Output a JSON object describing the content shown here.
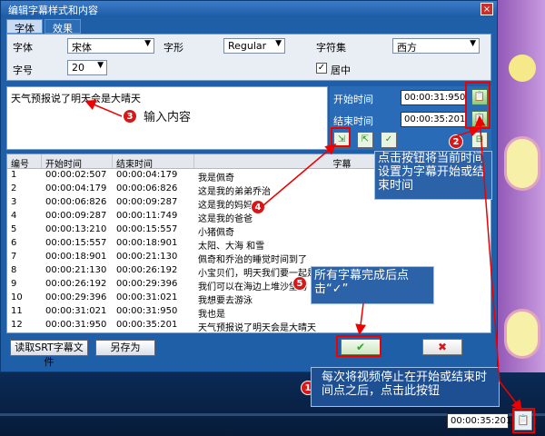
{
  "window": {
    "title": "编辑字幕样式和内容",
    "close": "×"
  },
  "tabs": [
    {
      "label": "字体"
    },
    {
      "label": "效果"
    }
  ],
  "props": {
    "font_label": "字体",
    "font_value": "宋体",
    "style_label": "字形",
    "style_value": "Regular",
    "charset_label": "字符集",
    "charset_value": "西方",
    "size_label": "字号",
    "size_value": "20",
    "center_label": "居中",
    "center_checked": "✓"
  },
  "editor": {
    "text": "天气预报说了明天会是大晴天"
  },
  "time": {
    "start_label": "开始时间",
    "start_value": "00:00:31:950",
    "end_label": "结束时间",
    "end_value": "00:00:35:201"
  },
  "table": {
    "headers": [
      "编号",
      "开始时间",
      "结束时间",
      "字幕"
    ],
    "rows": [
      [
        "1",
        "00:00:02:507",
        "00:00:04:179",
        "我是佩奇"
      ],
      [
        "2",
        "00:00:04:179",
        "00:00:06:826",
        "这是我的弟弟乔治"
      ],
      [
        "3",
        "00:00:06:826",
        "00:00:09:287",
        "这是我的妈妈"
      ],
      [
        "4",
        "00:00:09:287",
        "00:00:11:749",
        "这是我的爸爸"
      ],
      [
        "5",
        "00:00:13:210",
        "00:00:15:557",
        "小猪佩奇"
      ],
      [
        "6",
        "00:00:15:557",
        "00:00:18:901",
        "太阳、大海 和雪"
      ],
      [
        "7",
        "00:00:18:901",
        "00:00:21:130",
        "佩奇和乔治的睡觉时间到了"
      ],
      [
        "8",
        "00:00:21:130",
        "00:00:26:192",
        "小宝贝们，明天我们要一起是"
      ],
      [
        "9",
        "00:00:26:192",
        "00:00:29:396",
        "我们可以在海边上堆沙堡吗"
      ],
      [
        "10",
        "00:00:29:396",
        "00:00:31:021",
        "我想要去游泳"
      ],
      [
        "11",
        "00:00:31:021",
        "00:00:31:950",
        "我也是"
      ],
      [
        "12",
        "00:00:31:950",
        "00:00:35:201",
        "天气预报说了明天会是大晴天"
      ]
    ]
  },
  "buttons": {
    "read_srt": "读取SRT字幕文件",
    "save_as": "另存为",
    "ok": "✔",
    "cancel": "✖"
  },
  "player": {
    "time": "00:00:35:201"
  },
  "annotations": {
    "n1": "1",
    "n1_text": "每次将视频停止在开始或结束时间点之后，点击此按钮",
    "n2": "2",
    "n2_text": "点击按钮将当前时间设置为字幕开始或结束时间",
    "n3": "3",
    "n3_text": "输入内容",
    "n4": "4",
    "n5": "5",
    "n5_text": "所有字幕完成后点击“✓”"
  }
}
